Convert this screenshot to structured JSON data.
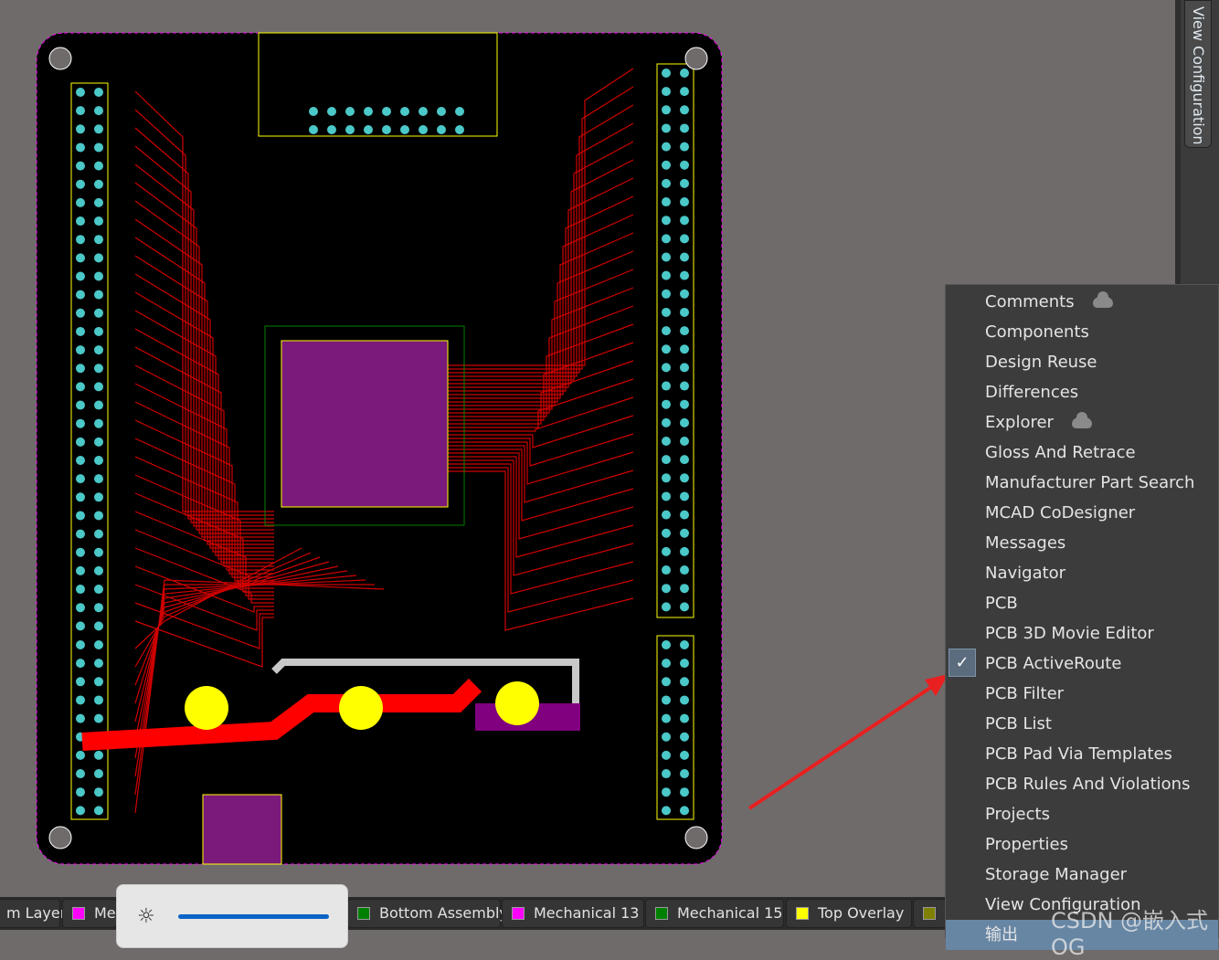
{
  "side_tab": {
    "label": "View Configuration"
  },
  "menu": {
    "items": [
      {
        "label": "Comments",
        "cloud": true
      },
      {
        "label": "Components"
      },
      {
        "label": "Design Reuse"
      },
      {
        "label": "Differences"
      },
      {
        "label": "Explorer",
        "cloud": true
      },
      {
        "label": "Gloss And Retrace"
      },
      {
        "label": "Manufacturer Part Search"
      },
      {
        "label": "MCAD CoDesigner"
      },
      {
        "label": "Messages"
      },
      {
        "label": "Navigator"
      },
      {
        "label": "PCB"
      },
      {
        "label": "PCB 3D Movie Editor"
      },
      {
        "label": "PCB ActiveRoute",
        "checked": true
      },
      {
        "label": "PCB Filter"
      },
      {
        "label": "PCB List"
      },
      {
        "label": "PCB Pad Via Templates"
      },
      {
        "label": "PCB Rules And Violations"
      },
      {
        "label": "Projects"
      },
      {
        "label": "Properties"
      },
      {
        "label": "Storage Manager"
      },
      {
        "label": "View Configuration"
      },
      {
        "label": "输出",
        "highlighted": true
      }
    ]
  },
  "layer_tabs": [
    {
      "label": "m Layer",
      "color": null
    },
    {
      "label": "Me",
      "color": "#ff00ff"
    },
    {
      "label": "Bottom Assembly",
      "color": "#008000"
    },
    {
      "label": "Mechanical 13",
      "color": "#ff00ff"
    },
    {
      "label": "Mechanical 15",
      "color": "#008000"
    },
    {
      "label": "Top Overlay",
      "color": "#ffff00"
    },
    {
      "label": "",
      "color": "#808000"
    }
  ],
  "brightness": {
    "icon": "sun-icon",
    "level": 1.0
  },
  "watermark": "CSDN @嵌入式OG",
  "colors": {
    "board": "#000000",
    "trace_top": "#ff0000",
    "trace_bottom": "#0000ff",
    "overlay": "#ffff00",
    "pad": "#4bc8c8",
    "mechanical": "#ff00ff"
  }
}
